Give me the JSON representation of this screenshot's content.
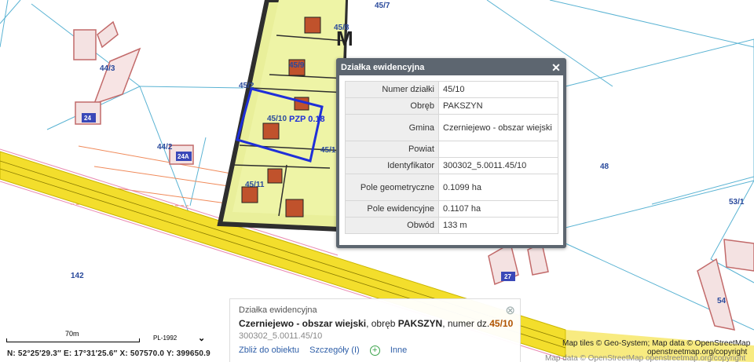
{
  "map": {
    "parcel_labels": {
      "p45_7": "45/7",
      "p45_8": "45/8",
      "p45_9": "45/9",
      "p45_2": "45/2",
      "p45_10": "45/10",
      "p45_1": "45/1",
      "p45_11": "45/11",
      "p44_3": "44/3",
      "p44_2": "44/2",
      "p48": "48",
      "p53_1": "53/1",
      "p142": "142",
      "p54": "54"
    },
    "house_numbers": {
      "h24": "24",
      "h24a": "24A",
      "h27": "27"
    },
    "zone_letter": "M",
    "pzp_label": "PZP 0.18"
  },
  "popup": {
    "title": "Działka ewidencyjna",
    "close": "✕",
    "rows": [
      {
        "key": "Numer działki",
        "value": "45/10"
      },
      {
        "key": "Obręb",
        "value": "PAKSZYN"
      },
      {
        "key": "Gmina",
        "value": "Czerniejewo - obszar wiejski"
      },
      {
        "key": "Powiat",
        "value": ""
      },
      {
        "key": "Identyfikator",
        "value": "300302_5.0011.45/10"
      },
      {
        "key": "Pole geometryczne",
        "value": "0.1099 ha"
      },
      {
        "key": "Pole ewidencyjne",
        "value": "0.1107 ha"
      },
      {
        "key": "Obwód",
        "value": "133 m"
      }
    ]
  },
  "info": {
    "title": "Działka ewidencyjna",
    "close": "⊗",
    "gmina": "Czerniejewo - obszar wiejski",
    "sep1": ", obręb ",
    "obreb": "PAKSZYN",
    "sep2": ", numer dz.",
    "number": "45/10",
    "identifier": "300302_5.0011.45/10",
    "actions": {
      "zoom": "Zbliż do obiektu",
      "details": "Szczegóły (I)",
      "plus": "+",
      "other": "Inne"
    }
  },
  "scale": {
    "label": "70m",
    "crs": "PL-1992",
    "crs_toggle": "⌄"
  },
  "coords": "N: 52°25′29.3″  E: 17°31′25.6″  X: 507570.0  Y: 399650.9",
  "attribution": {
    "line1": "Map tiles © Geo-System; Map data © OpenStreetMap",
    "line2": "openstreetmap.org/copyright",
    "ghost": "Map data © OpenStreetMap openstreetmap.org/copyright"
  },
  "colors": {
    "road": "#f3de2c",
    "parcel_fill": "#e9ef9a",
    "building": "#c0522c",
    "selection": "#1f2fd8",
    "parcel_line": "#5ab3d3",
    "popup_header": "#5d6670"
  }
}
